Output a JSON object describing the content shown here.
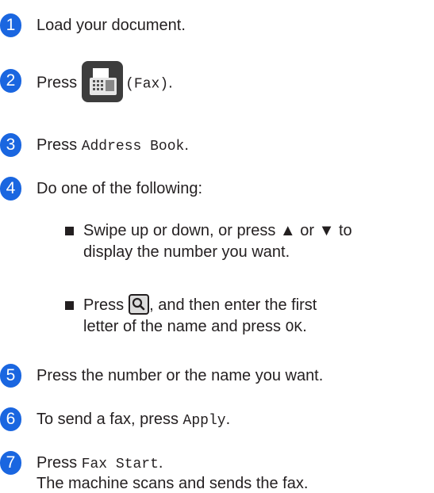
{
  "steps": [
    {
      "number": "1",
      "text": "Load your document."
    },
    {
      "number": "2",
      "prefix": "Press",
      "icon_label": "(Fax)",
      "suffix": "."
    },
    {
      "number": "3",
      "prefix": "Press ",
      "code": "Address Book",
      "suffix": "."
    },
    {
      "number": "4",
      "text": "Do one of the following:"
    },
    {
      "number": "5",
      "text": "Press the number or the name you want."
    },
    {
      "number": "6",
      "prefix": "To send a fax, press ",
      "code": "Apply",
      "suffix": "."
    },
    {
      "number": "7",
      "prefix": "Press ",
      "code": "Fax Start",
      "suffix": ".",
      "line2": "The machine scans and sends the fax."
    }
  ],
  "options": [
    {
      "line1": "Swipe up or down, or press ▲ or ▼ to",
      "line2": "display the number you want."
    },
    {
      "line1_prefix": "Press",
      "line1_suffix": ", and then enter the first",
      "line2_prefix": "letter of the name and press ",
      "line2_code": "OK",
      "line2_suffix": "."
    }
  ],
  "icons": {
    "fax": "fax-icon",
    "search": "search-icon"
  },
  "colors": {
    "step_badge": "#1a66e0"
  }
}
